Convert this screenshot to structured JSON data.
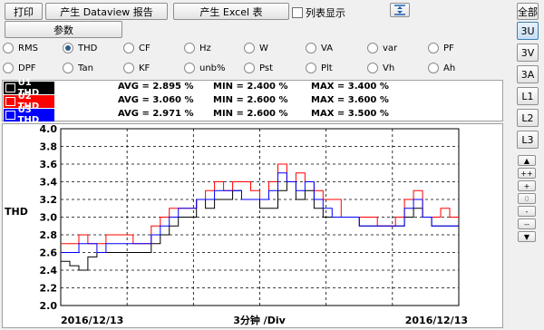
{
  "toolbar": {
    "print": "打印",
    "dataview_report": "产生 Dataview 报告",
    "excel_table": "产生 Excel 表",
    "list_display": "列表显示",
    "params": "参数"
  },
  "side": {
    "all": "全部",
    "buttons": [
      "3U",
      "3V",
      "3A",
      "L1",
      "L2",
      "L3"
    ],
    "active": "3U",
    "controls": [
      "▲",
      "++",
      "+",
      "0",
      "-",
      "--",
      "▼"
    ]
  },
  "radios": {
    "row1": [
      "RMS",
      "THD",
      "CF",
      "Hz",
      "W",
      "VA",
      "var",
      "PF"
    ],
    "row2": [
      "DPF",
      "Tan",
      "KF",
      "unb%",
      "Pst",
      "Plt",
      "Vh",
      "Ah"
    ],
    "selected": "THD"
  },
  "stats": [
    {
      "label": "U1 THD",
      "color": "#000000",
      "avg": "AVG = 2.895 %",
      "min": "MIN = 2.400 %",
      "max": "MAX = 3.400 %"
    },
    {
      "label": "U2 THD",
      "color": "#ff0000",
      "avg": "AVG = 3.060 %",
      "min": "MIN = 2.600 %",
      "max": "MAX = 3.600 %"
    },
    {
      "label": "U3 THD",
      "color": "#0000ff",
      "avg": "AVG = 2.971 %",
      "min": "MIN = 2.600 %",
      "max": "MAX = 3.500 %"
    }
  ],
  "chart_data": {
    "type": "line",
    "ylabel": "THD",
    "ylim": [
      2.0,
      4.0
    ],
    "yticks": [
      "4.0",
      "3.8",
      "3.6",
      "3.4",
      "3.2",
      "3.0",
      "2.8",
      "2.6",
      "2.4",
      "2.2",
      "2.0"
    ],
    "x_start": "2016/12/13",
    "x_end": "2016/12/13",
    "x_div": "3分钟 /Div",
    "grid": true,
    "series": [
      {
        "name": "U1 THD",
        "color": "#000000",
        "values": [
          2.5,
          2.45,
          2.4,
          2.55,
          2.6,
          2.6,
          2.6,
          2.6,
          2.6,
          2.6,
          2.7,
          2.8,
          2.9,
          3.0,
          3.0,
          3.2,
          3.1,
          3.2,
          3.2,
          3.3,
          3.2,
          3.2,
          3.1,
          3.1,
          3.3,
          3.4,
          3.2,
          3.3,
          3.1,
          3.0,
          3.0,
          3.0,
          3.0,
          2.9,
          2.9,
          2.9,
          2.9,
          2.9,
          3.0,
          3.1,
          3.0,
          2.9,
          2.9,
          2.9
        ]
      },
      {
        "name": "U2 THD",
        "color": "#ff0000",
        "values": [
          2.7,
          2.7,
          2.8,
          2.7,
          2.7,
          2.8,
          2.8,
          2.8,
          2.7,
          2.7,
          2.9,
          3.0,
          3.1,
          3.1,
          3.1,
          3.2,
          3.3,
          3.4,
          3.3,
          3.4,
          3.4,
          3.3,
          3.2,
          3.4,
          3.6,
          3.4,
          3.5,
          3.4,
          3.3,
          3.2,
          3.2,
          3.0,
          3.0,
          3.0,
          3.0,
          2.9,
          2.9,
          3.0,
          3.2,
          3.3,
          3.0,
          3.0,
          3.1,
          3.0
        ]
      },
      {
        "name": "U3 THD",
        "color": "#0000ff",
        "values": [
          2.6,
          2.6,
          2.7,
          2.7,
          2.6,
          2.7,
          2.7,
          2.7,
          2.7,
          2.7,
          2.8,
          2.9,
          3.0,
          3.1,
          3.1,
          3.2,
          3.2,
          3.3,
          3.3,
          3.3,
          3.2,
          3.2,
          3.2,
          3.3,
          3.5,
          3.4,
          3.3,
          3.4,
          3.2,
          3.1,
          3.0,
          3.0,
          3.0,
          2.9,
          2.9,
          2.9,
          2.9,
          2.9,
          3.1,
          3.2,
          3.0,
          2.9,
          2.9,
          2.9
        ]
      }
    ]
  }
}
